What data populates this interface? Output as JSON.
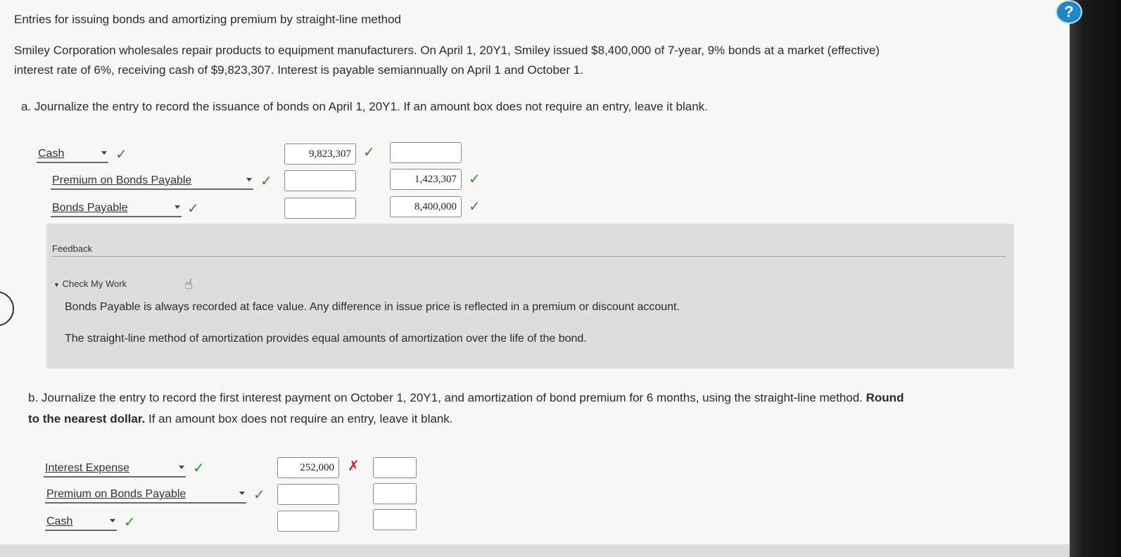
{
  "title": "Entries for issuing bonds and amortizing premium by straight-line method",
  "description_line1": "Smiley Corporation wholesales repair products to equipment manufacturers. On April 1, 20Y1, Smiley issued $8,400,000 of 7-year, 9% bonds at a market (effective)",
  "description_line2": "interest rate of 6%, receiving cash of $9,823,307. Interest is payable semiannually on April 1 and October 1.",
  "part_a": {
    "question": "a. Journalize the entry to record the issuance of bonds on April 1, 20Y1. If an amount box does not require an entry, leave it blank.",
    "rows": [
      {
        "account": "Cash",
        "debit": "9,823,307",
        "credit": ""
      },
      {
        "account": "Premium on Bonds Payable",
        "debit": "",
        "credit": "1,423,307"
      },
      {
        "account": "Bonds Payable",
        "debit": "",
        "credit": "8,400,000"
      }
    ],
    "check_glyph": "✓"
  },
  "feedback": {
    "title": "Feedback",
    "toggle": "Check My Work",
    "toggle_glyph": "▼",
    "text1": "Bonds Payable is always recorded at face value. Any difference in issue price is reflected in a premium or discount account.",
    "text2": "The straight-line method of amortization provides equal amounts of amortization over the life of the bond."
  },
  "part_b": {
    "question_line1_prefix": "b. Journalize the entry to record the first interest payment on October 1, 20Y1, and amortization of bond premium for 6 months, using the straight-line method.",
    "question_line1_bold": "Round",
    "question_line2_bold": "to the nearest dollar.",
    "question_line2_rest": " If an amount box does not require an entry, leave it blank.",
    "rows": [
      {
        "account": "Interest Expense",
        "debit": "252,000",
        "credit": ""
      },
      {
        "account": "Premium on Bonds Payable",
        "debit": "",
        "credit": ""
      },
      {
        "account": "Cash",
        "debit": "",
        "credit": ""
      }
    ],
    "check_glyph": "✓",
    "wrong_glyph": "✗"
  },
  "help_glyph": "?",
  "icons": {
    "help": "help-circle-icon",
    "hand": "hand-pointer-icon",
    "check": "check-icon",
    "cross": "x-icon",
    "dropdown": "caret-down-icon"
  },
  "colors": {
    "check": "#3a8a3a",
    "cross": "#cc2222",
    "help": "#1f86c9"
  }
}
